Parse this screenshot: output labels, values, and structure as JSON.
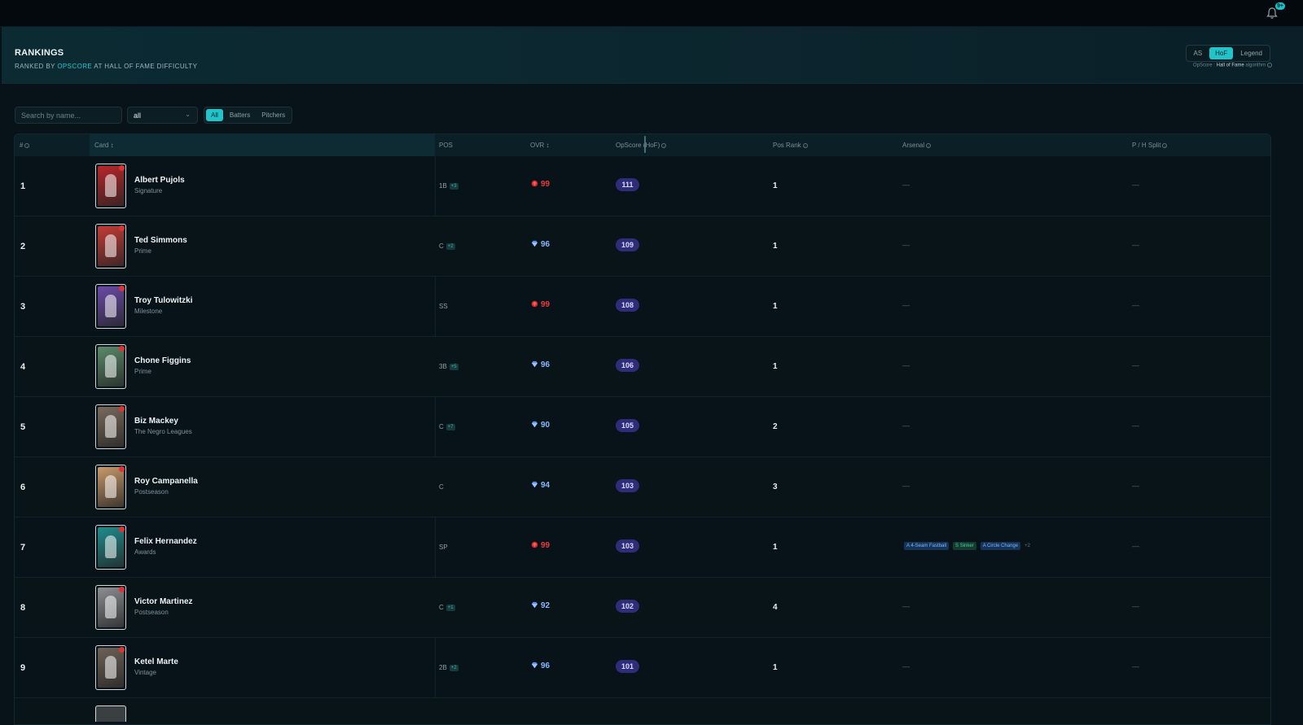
{
  "notifications": {
    "badge": "9+"
  },
  "header": {
    "title": "RANKINGS",
    "subtitle_prefix": "RANKED BY ",
    "subtitle_accent": "OPSCORE",
    "subtitle_suffix": " AT HALL OF FAME DIFFICULTY",
    "difficulty_options": [
      "AS",
      "HoF",
      "Legend"
    ],
    "difficulty_selected": "HoF",
    "algo_prefix": "OpScore : ",
    "algo_strong": "Hall of Fame",
    "algo_suffix": " algorithm"
  },
  "filters": {
    "search_placeholder": "Search by name...",
    "position_value": "all",
    "segments": [
      "All",
      "Batters",
      "Pitchers"
    ],
    "segment_selected": "All"
  },
  "table": {
    "columns": {
      "rank": "#",
      "card": "Card",
      "pos": "POS",
      "ovr": "OVR",
      "opscore": "OpScore (HoF)",
      "posrank": "Pos Rank",
      "arsenal": "Arsenal",
      "split": "P / H Split"
    },
    "rows": [
      {
        "rank": "1",
        "name": "Albert Pujols",
        "series": "Signature",
        "pos": "1B",
        "pos_extra": "+3",
        "ovr": "99",
        "tier": "red",
        "opscore": "111",
        "posrank": "1",
        "arsenal": "—",
        "split": "—",
        "card_color": "#b8262a"
      },
      {
        "rank": "2",
        "name": "Ted Simmons",
        "series": "Prime",
        "pos": "C",
        "pos_extra": "+2",
        "ovr": "96",
        "tier": "blue",
        "opscore": "109",
        "posrank": "1",
        "arsenal": "—",
        "split": "—",
        "card_color": "#c43b36"
      },
      {
        "rank": "3",
        "name": "Troy Tulowitzki",
        "series": "Milestone",
        "pos": "SS",
        "pos_extra": "",
        "ovr": "99",
        "tier": "red",
        "opscore": "108",
        "posrank": "1",
        "arsenal": "—",
        "split": "—",
        "card_color": "#6b4aa8"
      },
      {
        "rank": "4",
        "name": "Chone Figgins",
        "series": "Prime",
        "pos": "3B",
        "pos_extra": "+5",
        "ovr": "96",
        "tier": "blue",
        "opscore": "106",
        "posrank": "1",
        "arsenal": "—",
        "split": "—",
        "card_color": "#5c8a6a"
      },
      {
        "rank": "5",
        "name": "Biz Mackey",
        "series": "The Negro Leagues",
        "pos": "C",
        "pos_extra": "+7",
        "ovr": "90",
        "tier": "blue",
        "opscore": "105",
        "posrank": "2",
        "arsenal": "—",
        "split": "—",
        "card_color": "#7a6a5c"
      },
      {
        "rank": "6",
        "name": "Roy Campanella",
        "series": "Postseason",
        "pos": "C",
        "pos_extra": "",
        "ovr": "94",
        "tier": "blue",
        "opscore": "103",
        "posrank": "3",
        "arsenal": "—",
        "split": "—",
        "card_color": "#c99a6a"
      },
      {
        "rank": "7",
        "name": "Felix Hernandez",
        "series": "Awards",
        "pos": "SP",
        "pos_extra": "",
        "ovr": "99",
        "tier": "red",
        "opscore": "103",
        "posrank": "1",
        "arsenal": "",
        "split": "—",
        "card_color": "#1f8c8c",
        "arsenal_tags": [
          {
            "grade": "A",
            "pitch": "4-Seam Fastball",
            "kind": "a"
          },
          {
            "grade": "S",
            "pitch": "Sinker",
            "kind": "s"
          },
          {
            "grade": "A",
            "pitch": "Circle Change",
            "kind": "a"
          }
        ],
        "arsenal_more": "+2"
      },
      {
        "rank": "8",
        "name": "Victor Martinez",
        "series": "Postseason",
        "pos": "C",
        "pos_extra": "+1",
        "ovr": "92",
        "tier": "blue",
        "opscore": "102",
        "posrank": "4",
        "arsenal": "—",
        "split": "—",
        "card_color": "#8d8f93"
      },
      {
        "rank": "9",
        "name": "Ketel Marte",
        "series": "Vintage",
        "pos": "2B",
        "pos_extra": "+2",
        "ovr": "96",
        "tier": "blue",
        "opscore": "101",
        "posrank": "1",
        "arsenal": "—",
        "split": "—",
        "card_color": "#6e6258"
      }
    ]
  },
  "colors": {
    "accent": "#20c4c9",
    "tier_red": "#ef3b3b",
    "tier_blue": "#8ab8ff",
    "opscore_pill": "#2f2d7a"
  }
}
